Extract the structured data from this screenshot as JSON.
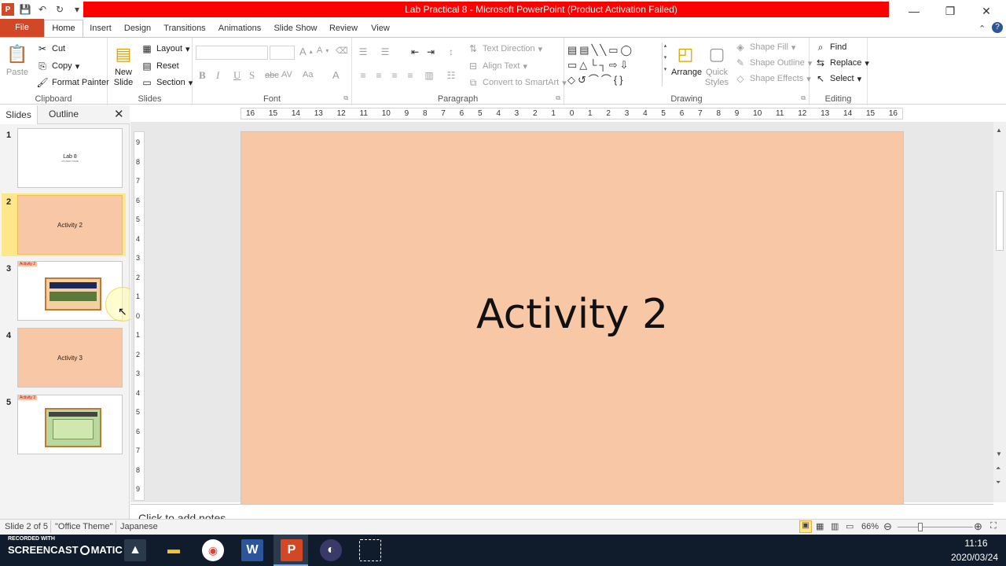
{
  "window": {
    "title": "Lab Practical 8  -  Microsoft PowerPoint (Product Activation Failed)",
    "controls": {
      "minimize": "—",
      "restore": "❐",
      "close": "✕"
    }
  },
  "ribbon_tabs": {
    "file": "File",
    "items": [
      "Home",
      "Insert",
      "Design",
      "Transitions",
      "Animations",
      "Slide Show",
      "Review",
      "View"
    ]
  },
  "clipboard": {
    "paste": "Paste",
    "cut": "Cut",
    "copy": "Copy",
    "format_painter": "Format Painter",
    "label": "Clipboard"
  },
  "slides_group": {
    "new_slide": "New Slide",
    "layout": "Layout",
    "reset": "Reset",
    "section": "Section",
    "label": "Slides"
  },
  "font_group": {
    "label": "Font",
    "bold": "B",
    "italic": "I",
    "underline": "U",
    "strike": "S",
    "abc": "abc",
    "av": "AV",
    "aa": "Aa",
    "grow": "A",
    "shrink": "A"
  },
  "paragraph_group": {
    "label": "Paragraph",
    "text_direction": "Text Direction",
    "align_text": "Align Text",
    "convert_smartart": "Convert to SmartArt"
  },
  "drawing_group": {
    "label": "Drawing",
    "arrange": "Arrange",
    "quick_styles": "Quick Styles",
    "shape_fill": "Shape Fill",
    "shape_outline": "Shape Outline",
    "shape_effects": "Shape Effects"
  },
  "editing_group": {
    "label": "Editing",
    "find": "Find",
    "replace": "Replace",
    "select": "Select"
  },
  "pane": {
    "slides_tab": "Slides",
    "outline_tab": "Outline"
  },
  "thumbnails": [
    {
      "num": "1",
      "title": "Lab 8",
      "subtitle": "AKUSER NAME"
    },
    {
      "num": "2",
      "title": "Activity 2"
    },
    {
      "num": "3",
      "title": "Activity 2"
    },
    {
      "num": "4",
      "title": "Activity 3"
    },
    {
      "num": "5",
      "title": "Activity 3"
    }
  ],
  "ruler": {
    "labels": [
      "16",
      "15",
      "14",
      "13",
      "12",
      "11",
      "10",
      "9",
      "8",
      "7",
      "6",
      "5",
      "4",
      "3",
      "2",
      "1",
      "0",
      "1",
      "2",
      "3",
      "4",
      "5",
      "6",
      "7",
      "8",
      "9",
      "10",
      "11",
      "12",
      "13",
      "14",
      "15",
      "16"
    ]
  },
  "slide": {
    "title": "Activity 2",
    "background": "#f8c8a6"
  },
  "notes": {
    "placeholder": "Click to add notes"
  },
  "status": {
    "slide_info": "Slide 2 of 5",
    "theme": "\"Office Theme\"",
    "language": "Japanese",
    "zoom": "66%"
  },
  "taskbar": {
    "recorder_line1": "RECORDED WITH",
    "recorder_line2": "SCREENCAST",
    "recorder_line3": "MATIC",
    "time": "11:16",
    "date": "2020/03/24"
  },
  "colors": {
    "file_tab": "#d24726",
    "activation_bar": "#ff0000",
    "taskbar": "#101c2c",
    "selected_thumb": "#fde78a"
  }
}
